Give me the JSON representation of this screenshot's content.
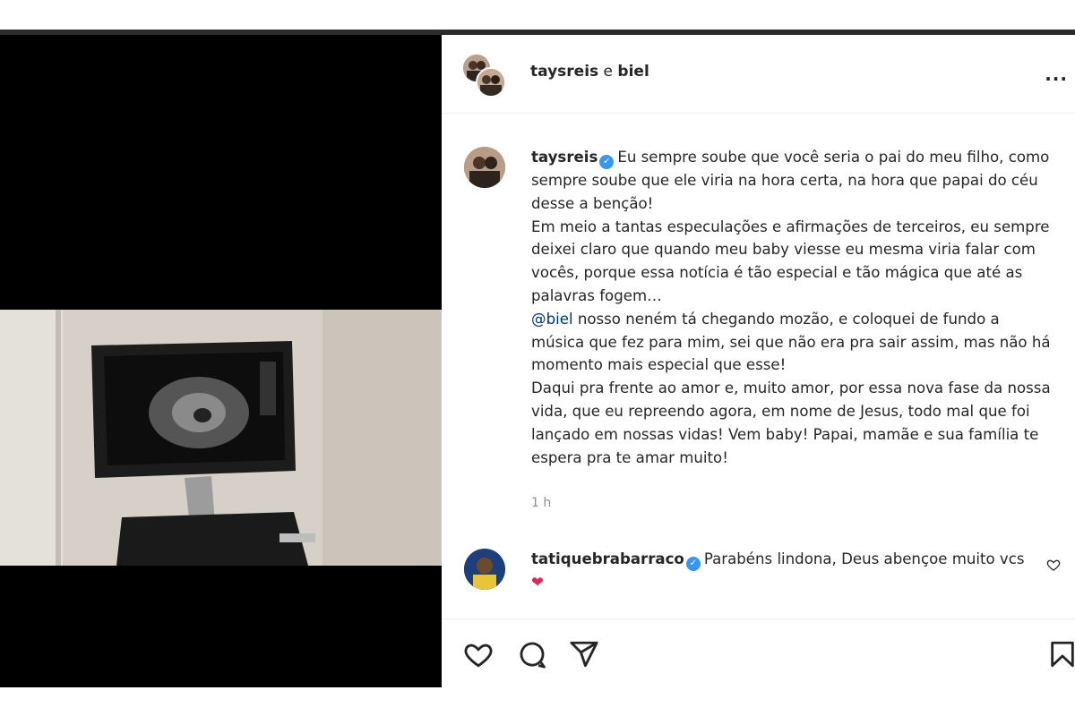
{
  "header": {
    "user1": "taysreis",
    "joiner": "e",
    "user2": "biel",
    "more_label": "..."
  },
  "caption": {
    "username": "taysreis",
    "text_1": "Eu sempre soube que você seria o pai do meu filho, como sempre soube que ele viria na hora certa, na hora que papai do céu desse a benção!",
    "text_2": "Em meio a tantas especulações e afirmações de terceiros, eu sempre deixei claro que quando meu baby viesse eu mesma viria falar com vocês, porque essa notícia é tão especial e tão mágica que até as palavras fogem…",
    "mention": "@biel",
    "text_3": "nosso neném tá chegando mozão, e coloquei de fundo a música que fez para mim, sei que não era pra sair assim, mas não há momento mais especial que esse!",
    "text_4": "Daqui pra frente ao amor e, muito amor, por essa nova fase da nossa vida, que eu repreendo agora, em nome de Jesus, todo mal que foi lançado em nossas vidas! Vem baby! Papai, mamãe e sua família te espera pra te amar muito!",
    "time": "1 h"
  },
  "comment": {
    "username": "tatiquebrabarraco",
    "text": "Parabéns lindona, Deus abençoe muito vcs",
    "emoji": "❤"
  },
  "icons": {
    "verified": "verified-badge-icon",
    "like": "heart-outline-icon",
    "comment": "comment-icon",
    "share": "paper-plane-icon",
    "save": "bookmark-icon"
  },
  "colors": {
    "verified": "#3897f0",
    "mention": "#00376b",
    "time": "#8e8e8e"
  }
}
